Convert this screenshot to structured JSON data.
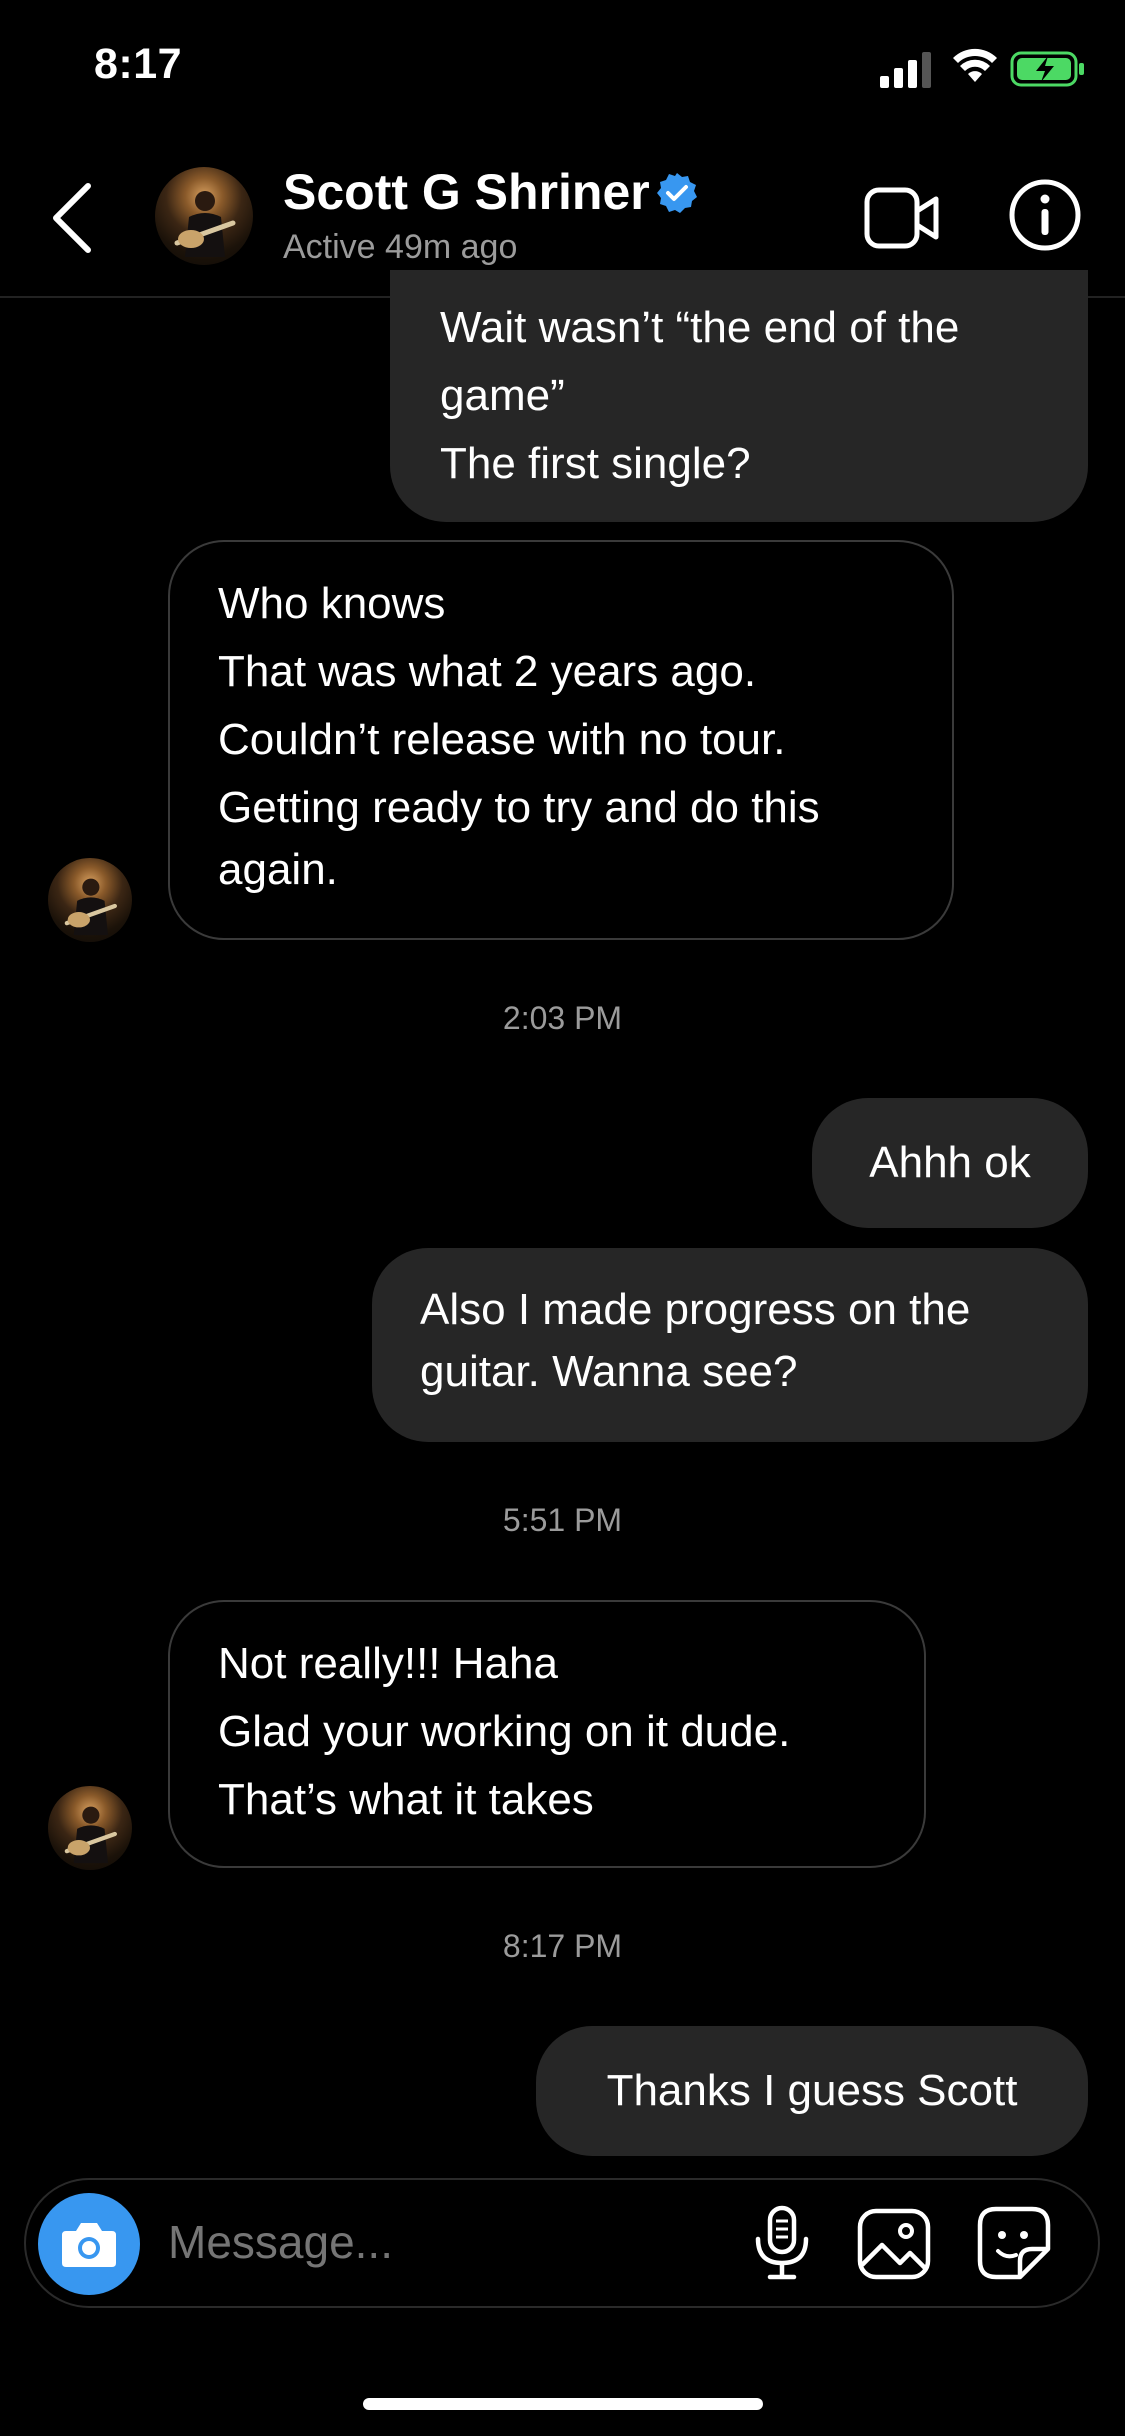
{
  "status_bar": {
    "time": "8:17",
    "signal_icon": "signal-bars-icon",
    "wifi_icon": "wifi-icon",
    "battery_icon": "battery-charging-icon",
    "battery_color": "#4cd964"
  },
  "header": {
    "contact_name": "Scott G Shriner",
    "verified_icon": "verified-badge-icon",
    "verified_color": "#3897f0",
    "status": "Active 49m ago",
    "back_icon": "chevron-left-icon",
    "video_icon": "video-camera-icon",
    "info_icon": "info-icon"
  },
  "messages": [
    {
      "direction": "outgoing",
      "lines": [
        "Wait wasn’t “the end of the",
        "game”",
        "The first single?"
      ]
    },
    {
      "direction": "incoming",
      "lines": [
        "Who knows",
        "That was what 2 years ago.",
        "Couldn’t release with no tour.",
        "Getting ready to try and do this",
        "again."
      ]
    },
    {
      "timestamp": "2:03 PM"
    },
    {
      "direction": "outgoing",
      "lines": [
        "Ahhh ok"
      ]
    },
    {
      "direction": "outgoing",
      "lines": [
        "Also I made progress on the",
        "guitar. Wanna see?"
      ]
    },
    {
      "timestamp": "5:51 PM"
    },
    {
      "direction": "incoming",
      "lines": [
        "Not really!!! Haha",
        "Glad your working on it dude.",
        "That’s what it takes"
      ]
    },
    {
      "timestamp": "8:17 PM"
    },
    {
      "direction": "outgoing",
      "lines": [
        "Thanks I guess Scott"
      ]
    }
  ],
  "composer": {
    "camera_icon": "camera-icon",
    "camera_color": "#3897f0",
    "placeholder": "Message...",
    "mic_icon": "microphone-icon",
    "gallery_icon": "gallery-icon",
    "sticker_icon": "sticker-icon"
  }
}
